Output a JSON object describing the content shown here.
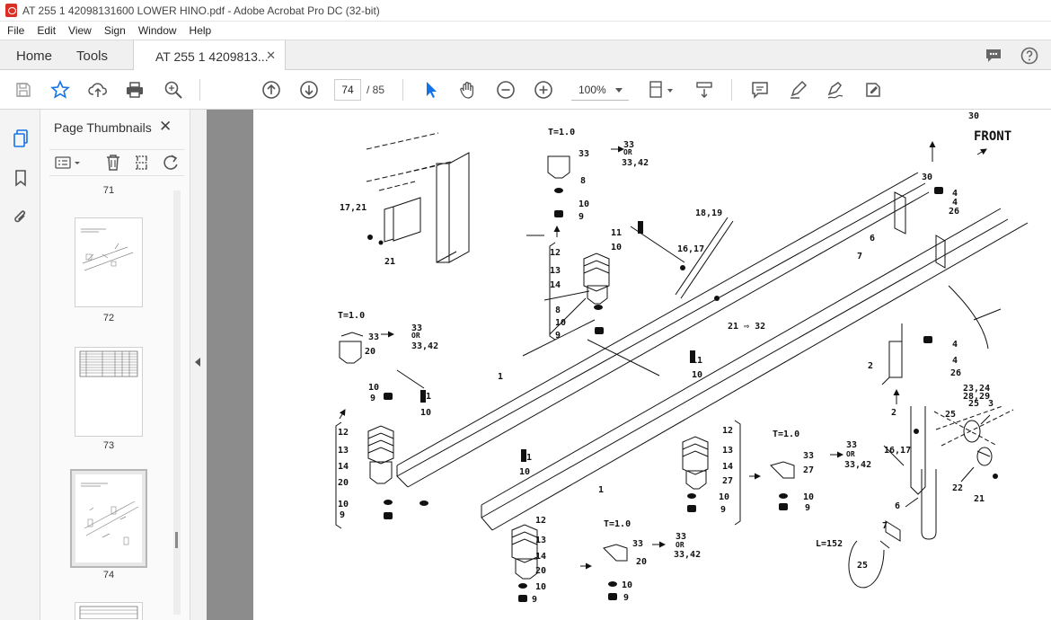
{
  "window": {
    "title": "AT 255 1 42098131600 LOWER HINO.pdf - Adobe Acrobat Pro DC (32-bit)"
  },
  "menu": [
    "File",
    "Edit",
    "View",
    "Sign",
    "Window",
    "Help"
  ],
  "tabs": {
    "home": "Home",
    "tools": "Tools",
    "document": "AT 255 1 4209813...",
    "close": "✕"
  },
  "toolbar": {
    "current_page": "74",
    "total_pages": "/ 85",
    "zoom": "100%"
  },
  "panel": {
    "title": "Page Thumbnails",
    "close": "✕",
    "thumbnails": [
      {
        "label": "71"
      },
      {
        "label": "72"
      },
      {
        "label": "73"
      },
      {
        "label": "74",
        "selected": true
      }
    ]
  },
  "drawing": {
    "front": "FRONT",
    "labels": {
      "t10": "T=1.0",
      "or": "OR",
      "l152": "L=152",
      "33": "33",
      "33_42": "33,42",
      "1": "1",
      "2": "2",
      "3": "3",
      "4": "4",
      "6": "6",
      "7": "7",
      "8": "8",
      "9": "9",
      "10": "10",
      "11": "11",
      "12": "12",
      "13": "13",
      "14": "14",
      "20": "20",
      "21": "21",
      "22": "22",
      "25": "25",
      "26": "26",
      "27": "27",
      "30": "30",
      "16_17": "16,17",
      "17_21": "17,21",
      "18_19": "18,19",
      "23_24": "23,24",
      "28_29": "28,29",
      "21_32": "21 ⇨ 32"
    }
  }
}
